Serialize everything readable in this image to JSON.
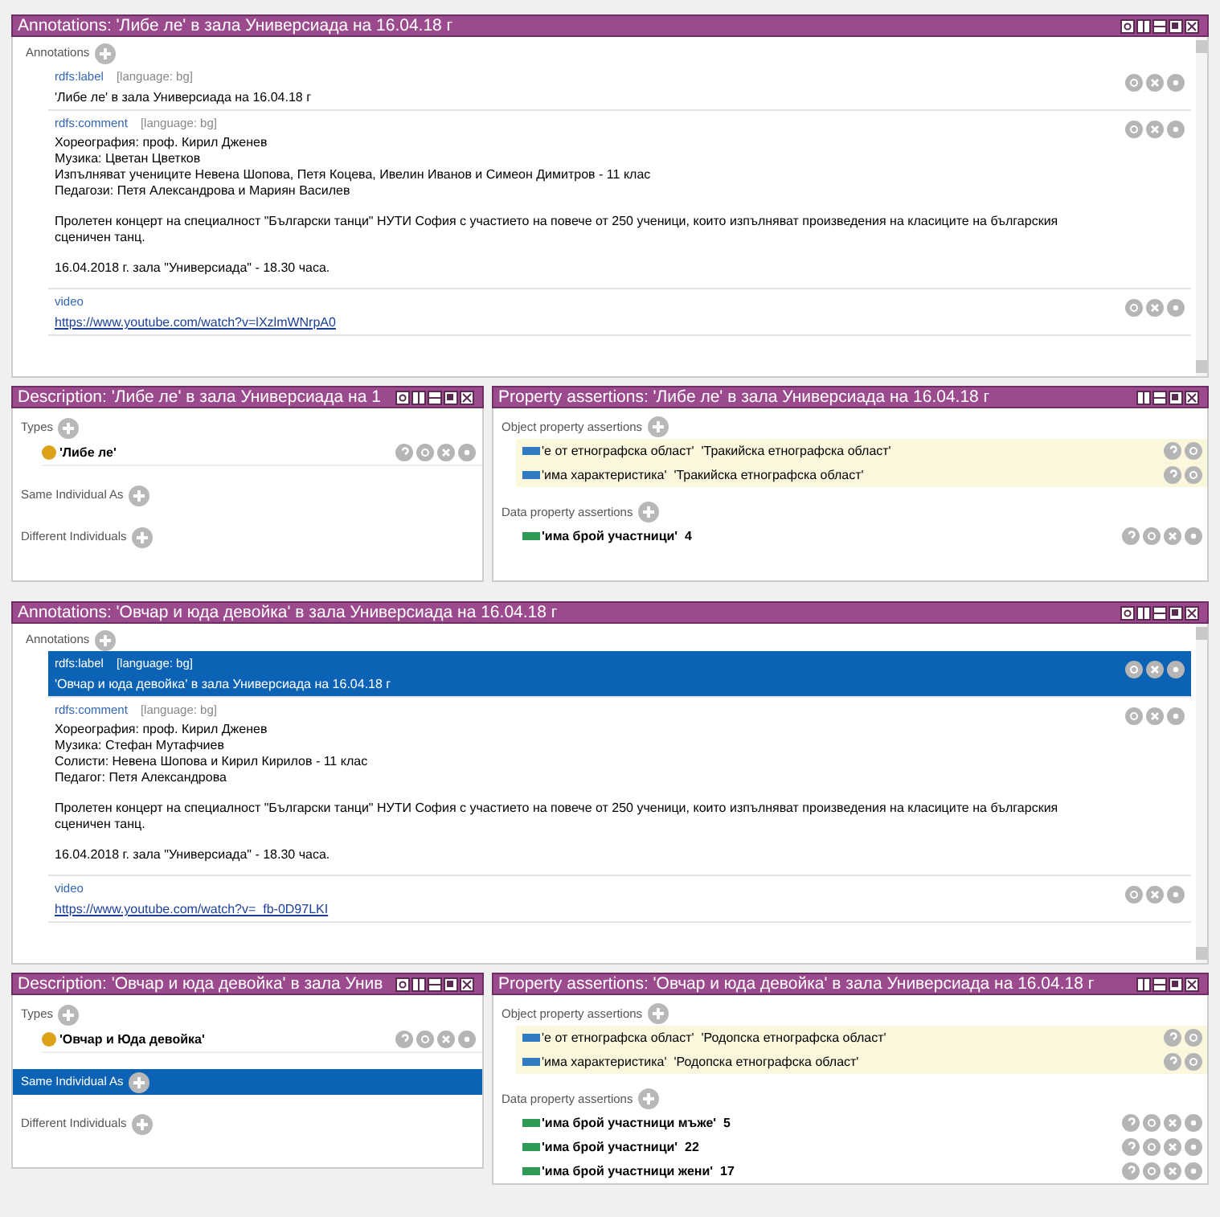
{
  "blocks": [
    {
      "annotations_panel": {
        "title": "Annotations: 'Либе ле' в зала Универсиада на 16.04.18 г",
        "section_label": "Annotations",
        "items": [
          {
            "property": "rdfs:label",
            "language": "[language: bg]",
            "kind": "text",
            "selected": false,
            "lines": [
              "'Либе ле' в зала Универсиада на 16.04.18 г"
            ]
          },
          {
            "property": "rdfs:comment",
            "language": "[language: bg]",
            "kind": "text",
            "selected": false,
            "paragraphs": [
              [
                "Хореография: проф. Кирил Дженев",
                "Музика: Цветан Цветков",
                "Изпълняват учениците Невена Шопова, Петя Коцева, Ивелин Иванов и Симеон Димитров - 11 клас",
                "Педагози: Петя Александрова и Мариян Василев"
              ],
              [
                "Пролетен концерт на специалност \"Български танци\" НУТИ София с участието на повече от 250 ученици, които изпълняват произведения на класиците на българския",
                "сценичен танц."
              ],
              [
                "16.04.2018 г. зала \"Универсиада\" - 18.30 часа."
              ]
            ]
          },
          {
            "property": "video",
            "kind": "link",
            "selected": false,
            "lines": [
              "https://www.youtube.com/watch?v=lXzlmWNrpA0"
            ]
          }
        ]
      },
      "description_panel": {
        "title": "Description: 'Либе ле' в зала Универсиада на 1",
        "sections": [
          {
            "label": "Types",
            "selected": false,
            "items": [
              {
                "text": "'Либе ле'"
              }
            ]
          },
          {
            "label": "Same Individual As",
            "selected": false
          },
          {
            "label": "Different Individuals",
            "selected": false
          }
        ]
      },
      "property_panel": {
        "title": "Property assertions: 'Либе ле' в зала Универсиада на 16.04.18 г",
        "sections": [
          {
            "label": "Object property assertions",
            "kind": "object",
            "items": [
              {
                "property": "'е от етнографска област'",
                "value": "'Тракийска етнографска област'"
              },
              {
                "property": "'има характеристика'",
                "value": "'Тракийска етнографска област'"
              }
            ]
          },
          {
            "label": "Data property assertions",
            "kind": "data",
            "items": [
              {
                "property": "'има брой участници'",
                "value": "4"
              }
            ]
          }
        ]
      }
    },
    {
      "annotations_panel": {
        "title": "Annotations: 'Овчар и юда девойка' в зала Универсиада на 16.04.18 г",
        "section_label": "Annotations",
        "items": [
          {
            "property": "rdfs:label",
            "language": "[language: bg]",
            "kind": "text",
            "selected": true,
            "lines": [
              "'Овчар и юда девойка' в зала Универсиада на 16.04.18 г"
            ]
          },
          {
            "property": "rdfs:comment",
            "language": "[language: bg]",
            "kind": "text",
            "selected": false,
            "paragraphs": [
              [
                "Хореография: проф. Кирил Дженев",
                "Музика: Стефан Мутафчиев",
                "Солисти: Невена Шопова и Кирил Кирилов - 11 клас",
                "Педагог: Петя Александрова"
              ],
              [
                "Пролетен концерт на специалност \"Български танци\" НУТИ София с участието на повече от 250 ученици, които изпълняват произведения на класиците на българския",
                "сценичен танц."
              ],
              [
                "16.04.2018 г. зала \"Универсиада\" - 18.30 часа."
              ]
            ]
          },
          {
            "property": "video",
            "kind": "link",
            "selected": false,
            "lines": [
              "https://www.youtube.com/watch?v=_fb-0D97LKI"
            ]
          }
        ]
      },
      "description_panel": {
        "title": "Description: 'Овчар и юда девойка' в зала Унив",
        "sections": [
          {
            "label": "Types",
            "selected": false,
            "items": [
              {
                "text": "'Овчар и Юда девойка'"
              }
            ]
          },
          {
            "label": "Same Individual As",
            "selected": true
          },
          {
            "label": "Different Individuals",
            "selected": false
          }
        ]
      },
      "property_panel": {
        "title": "Property assertions: 'Овчар и юда девойка' в зала Универсиада на 16.04.18 г",
        "sections": [
          {
            "label": "Object property assertions",
            "kind": "object",
            "items": [
              {
                "property": "'е от етнографска област'",
                "value": "'Родопска етнографска област'"
              },
              {
                "property": "'има характеристика'",
                "value": "'Родопска етнографска област'"
              }
            ]
          },
          {
            "label": "Data property assertions",
            "kind": "data",
            "items": [
              {
                "property": "'има брой участници мъже'",
                "value": "5"
              },
              {
                "property": "'има брой участници'",
                "value": "22"
              },
              {
                "property": "'има брой участници жени'",
                "value": "17"
              }
            ]
          }
        ]
      }
    }
  ]
}
